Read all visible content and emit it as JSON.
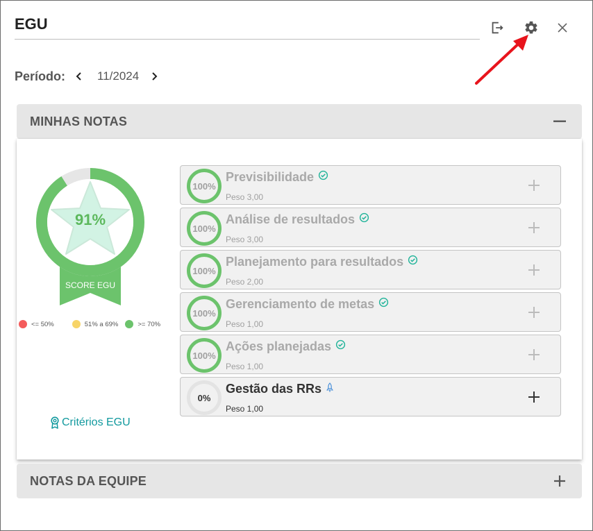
{
  "header": {
    "title": "EGU"
  },
  "period": {
    "label": "Período:",
    "value": "11/2024"
  },
  "my_notes": {
    "title": "MINHAS NOTAS",
    "score": {
      "value": "91%",
      "label": "SCORE EGU",
      "fraction": 0.91
    },
    "legend": [
      {
        "label": "<= 50%",
        "color": "#f45b5b"
      },
      {
        "label": "51% a 69%",
        "color": "#f7d468"
      },
      {
        "label": ">= 70%",
        "color": "#6cc36c"
      }
    ],
    "criteria_link": "Critérios EGU",
    "items": [
      {
        "percent": "100%",
        "name": "Previsibilidade",
        "weight": "Peso 3,00",
        "status_icon": "check-badge-icon"
      },
      {
        "percent": "100%",
        "name": "Análise de resultados",
        "weight": "Peso 3,00",
        "status_icon": "check-badge-icon"
      },
      {
        "percent": "100%",
        "name": "Planejamento para resultados",
        "weight": "Peso 2,00",
        "status_icon": "check-badge-icon"
      },
      {
        "percent": "100%",
        "name": "Gerenciamento de metas",
        "weight": "Peso 1,00",
        "status_icon": "check-badge-icon"
      },
      {
        "percent": "100%",
        "name": "Ações planejadas",
        "weight": "Peso 1,00",
        "status_icon": "check-badge-icon"
      },
      {
        "percent": "0%",
        "name": "Gestão das RRs",
        "weight": "Peso 1,00",
        "status_icon": "rocket-icon"
      }
    ]
  },
  "team_notes": {
    "title": "NOTAS DA EQUIPE"
  },
  "colors": {
    "accent_green": "#6cc36c",
    "teal_link": "#11999e",
    "annotation_red": "#e8141c"
  }
}
